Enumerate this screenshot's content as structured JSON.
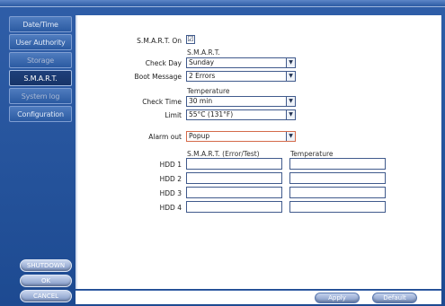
{
  "sidebar": {
    "items": [
      {
        "label": "Date/Time"
      },
      {
        "label": "User Authority"
      },
      {
        "label": "Storage"
      },
      {
        "label": "S.M.A.R.T."
      },
      {
        "label": "System log"
      },
      {
        "label": "Configuration"
      }
    ],
    "buttons": {
      "shutdown": "SHUTDOWN",
      "ok": "OK",
      "cancel": "CANCEL"
    }
  },
  "form": {
    "smart_on_label": "S.M.A.R.T. On",
    "smart_on_checked": "☑",
    "smart_group": "S.M.A.R.T.",
    "check_day_label": "Check Day",
    "check_day_value": "Sunday",
    "boot_message_label": "Boot Message",
    "boot_message_value": "2 Errors",
    "temperature_group": "Temperature",
    "check_time_label": "Check Time",
    "check_time_value": "30 min",
    "limit_label": "Limit",
    "limit_value": "55°C (131°F)",
    "alarm_out_label": "Alarm out",
    "alarm_out_value": "Popup",
    "hdd_col_smart": "S.M.A.R.T. (Error/Test)",
    "hdd_col_temp": "Temperature",
    "hdd_rows": [
      {
        "label": "HDD 1",
        "smart": "",
        "temp": ""
      },
      {
        "label": "HDD 2",
        "smart": "",
        "temp": ""
      },
      {
        "label": "HDD 3",
        "smart": "",
        "temp": ""
      },
      {
        "label": "HDD 4",
        "smart": "",
        "temp": ""
      }
    ]
  },
  "footer": {
    "apply": "Apply",
    "default": "Default"
  },
  "colors": {
    "frame": "#2f5ea8",
    "active_item": "#1e3f7a",
    "alarm_border": "#d46a4a"
  }
}
